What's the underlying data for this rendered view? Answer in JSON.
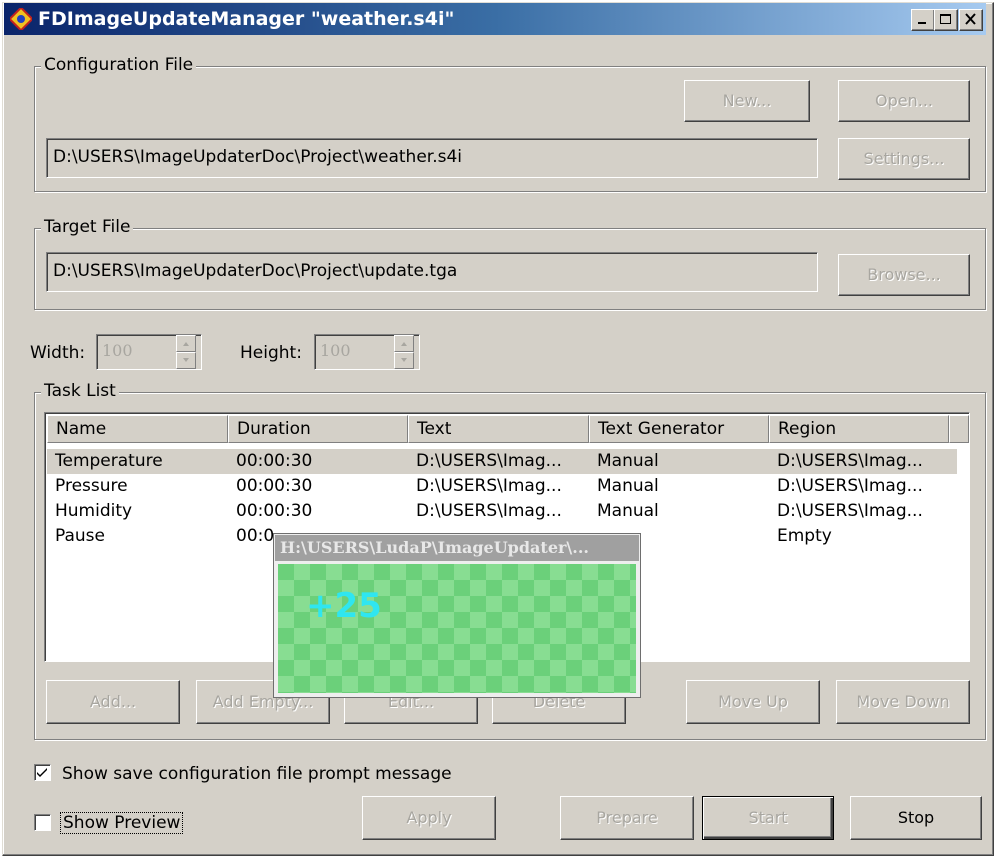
{
  "window": {
    "title": "FDImageUpdateManager \"weather.s4i\""
  },
  "configuration": {
    "group_label": "Configuration File",
    "new_label": "New...",
    "open_label": "Open...",
    "settings_label": "Settings...",
    "path": "D:\\USERS\\ImageUpdaterDoc\\Project\\weather.s4i"
  },
  "target": {
    "group_label": "Target File",
    "path": "D:\\USERS\\ImageUpdaterDoc\\Project\\update.tga",
    "browse_label": "Browse..."
  },
  "dimensions": {
    "width_label": "Width:",
    "width_value": "100",
    "height_label": "Height:",
    "height_value": "100"
  },
  "tasks": {
    "group_label": "Task List",
    "columns": [
      "Name",
      "Duration",
      "Text",
      "Text Generator",
      "Region"
    ],
    "rows": [
      {
        "name": "Temperature",
        "duration": "00:00:30",
        "text": "D:\\USERS\\Imag...",
        "generator": "Manual",
        "region": "D:\\USERS\\Imag..."
      },
      {
        "name": "Pressure",
        "duration": "00:00:30",
        "text": "D:\\USERS\\Imag...",
        "generator": "Manual",
        "region": "D:\\USERS\\Imag..."
      },
      {
        "name": "Humidity",
        "duration": "00:00:30",
        "text": "D:\\USERS\\Imag...",
        "generator": "Manual",
        "region": "D:\\USERS\\Imag..."
      },
      {
        "name": "Pause",
        "duration": "00:0",
        "text": "",
        "generator": "",
        "region": "Empty"
      }
    ],
    "buttons": {
      "add": "Add...",
      "add_empty": "Add Empty...",
      "edit": "Edit...",
      "delete": "Delete",
      "move_up": "Move Up",
      "move_down": "Move Down"
    }
  },
  "preview_popup": {
    "title": "H:\\USERS\\LudaP\\ImageUpdater\\...",
    "value": "+25"
  },
  "options": {
    "save_prompt_label": "Show save configuration file prompt message",
    "save_prompt_checked": true,
    "show_preview_label": "Show Preview",
    "show_preview_checked": false
  },
  "actions": {
    "apply": "Apply",
    "prepare": "Prepare",
    "start": "Start",
    "stop": "Stop"
  },
  "colors": {
    "dialog_face": "#d4d0c8",
    "title_active": "#0a246a",
    "preview_green": "#6bd07a",
    "preview_text": "#2fe6f0"
  }
}
